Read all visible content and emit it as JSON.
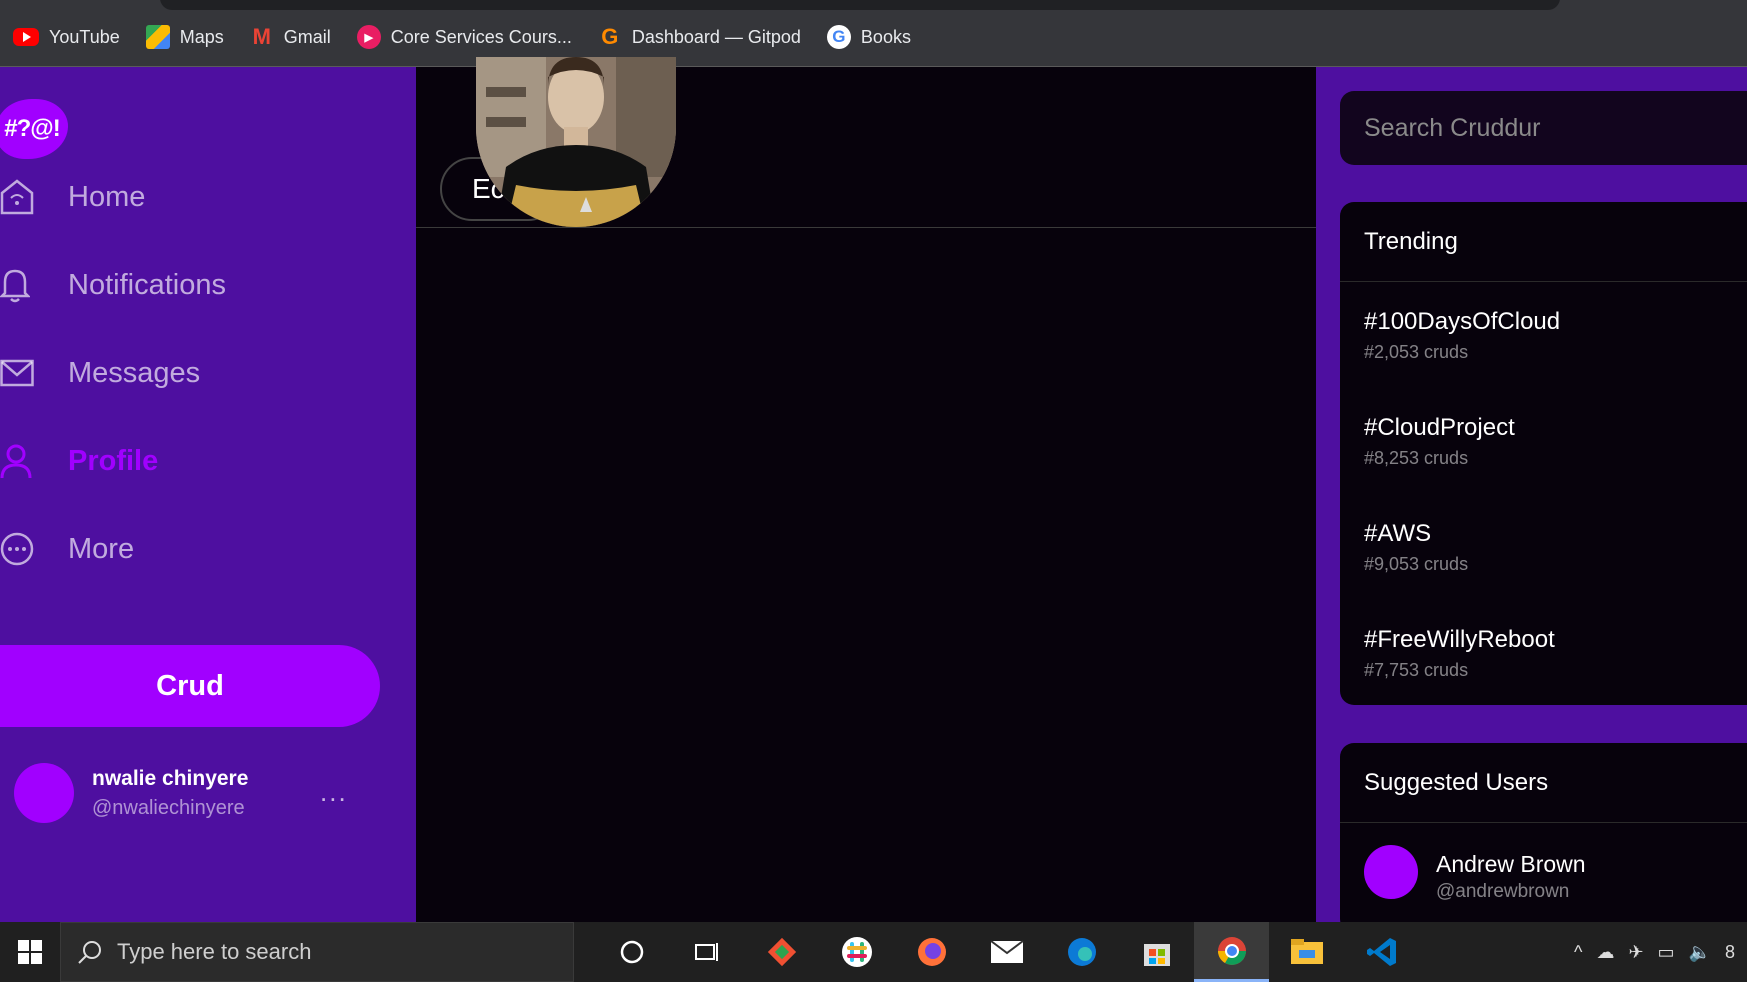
{
  "bookmarks": [
    {
      "label": "YouTube",
      "icon": "youtube-icon"
    },
    {
      "label": "Maps",
      "icon": "maps-icon"
    },
    {
      "label": "Gmail",
      "icon": "gmail-icon"
    },
    {
      "label": "Core Services Cours...",
      "icon": "core-services-icon"
    },
    {
      "label": "Dashboard — Gitpod",
      "icon": "gitpod-icon"
    },
    {
      "label": "Books",
      "icon": "google-icon"
    }
  ],
  "logo": {
    "text": "#?@!"
  },
  "nav": [
    {
      "label": "Home",
      "icon": "home-icon"
    },
    {
      "label": "Notifications",
      "icon": "bell-icon"
    },
    {
      "label": "Messages",
      "icon": "envelope-icon"
    },
    {
      "label": "Profile",
      "icon": "user-icon",
      "active": true
    },
    {
      "label": "More",
      "icon": "more-circle-icon"
    }
  ],
  "crud_button": "Crud",
  "current_user": {
    "name": "nwalie chinyere",
    "handle": "@nwaliechinyere",
    "more": "..."
  },
  "main": {
    "edit_button": "Ec"
  },
  "search": {
    "placeholder": "Search Cruddur"
  },
  "trending": {
    "title": "Trending",
    "items": [
      {
        "tag": "#100DaysOfCloud",
        "count": "#2,053 cruds"
      },
      {
        "tag": "#CloudProject",
        "count": "#8,253 cruds"
      },
      {
        "tag": "#AWS",
        "count": "#9,053 cruds"
      },
      {
        "tag": "#FreeWillyReboot",
        "count": "#7,753 cruds"
      }
    ]
  },
  "suggested": {
    "title": "Suggested Users",
    "users": [
      {
        "name": "Andrew Brown",
        "handle": "@andrewbrown"
      }
    ]
  },
  "taskbar": {
    "search_placeholder": "Type here to search",
    "clock_fragment": "8"
  },
  "colors": {
    "accent": "#a100ff",
    "sidebar": "#4e0fa0",
    "background": "#07020c"
  }
}
